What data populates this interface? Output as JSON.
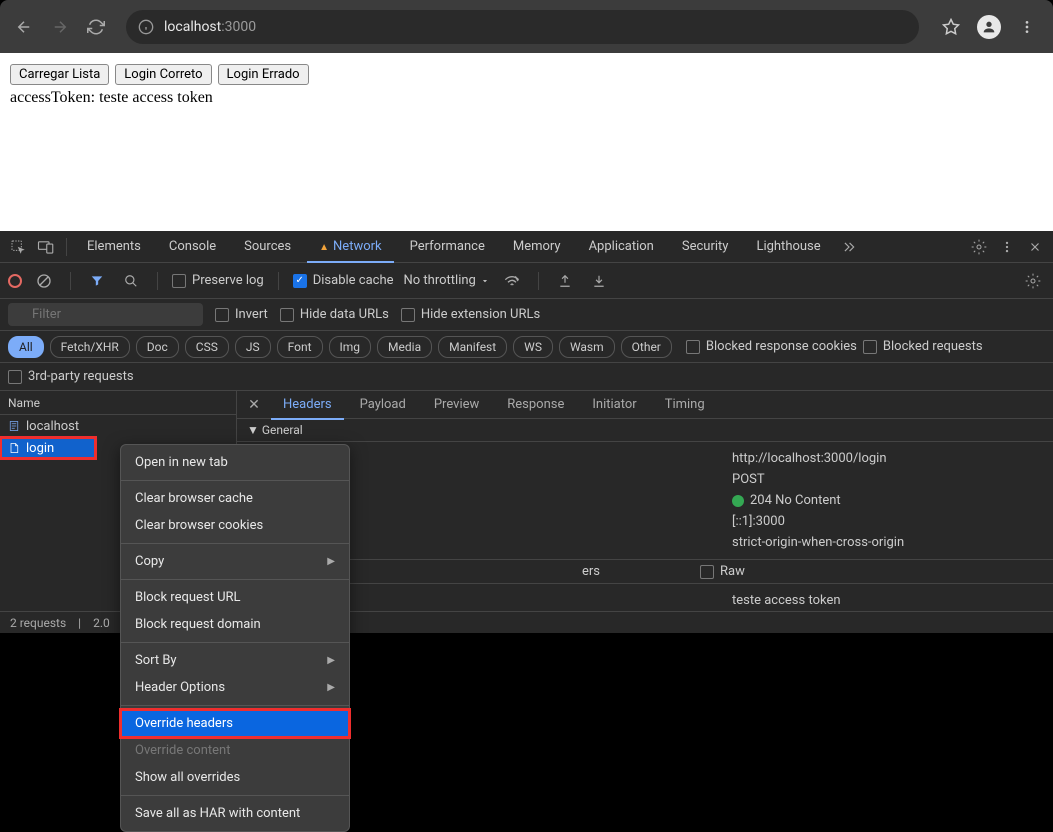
{
  "url": {
    "prefix": "localhost",
    "suffix": ":3000"
  },
  "page": {
    "buttons": [
      "Carregar Lista",
      "Login Correto",
      "Login Errado"
    ],
    "text": "accessToken: teste access token"
  },
  "devtools_tabs": [
    "Elements",
    "Console",
    "Sources",
    "Network",
    "Performance",
    "Memory",
    "Application",
    "Security",
    "Lighthouse"
  ],
  "active_tab": "Network",
  "controls": {
    "preserve_log": "Preserve log",
    "disable_cache": "Disable cache",
    "throttling": "No throttling"
  },
  "filter": {
    "placeholder": "Filter",
    "invert": "Invert",
    "hide_data": "Hide data URLs",
    "hide_ext": "Hide extension URLs"
  },
  "types": [
    "All",
    "Fetch/XHR",
    "Doc",
    "CSS",
    "JS",
    "Font",
    "Img",
    "Media",
    "Manifest",
    "WS",
    "Wasm",
    "Other"
  ],
  "types_extra": {
    "blocked_cookies": "Blocked response cookies",
    "blocked_requests": "Blocked requests",
    "third_party": "3rd-party requests"
  },
  "request_list": {
    "header": "Name",
    "items": [
      "localhost",
      "login"
    ]
  },
  "detail_tabs": [
    "Headers",
    "Payload",
    "Preview",
    "Response",
    "Initiator",
    "Timing"
  ],
  "general": {
    "title": "General",
    "url": "http://localhost:3000/login",
    "method": "POST",
    "status": "204 No Content",
    "addr": "[::1]:3000",
    "policy": "strict-origin-when-cross-origin"
  },
  "response_headers": {
    "title": "ers",
    "raw": "Raw",
    "value": "teste access token"
  },
  "footer": {
    "requests": "2 requests",
    "transfer": "2.0"
  },
  "context_menu": [
    {
      "label": "Open in new tab",
      "type": "item"
    },
    {
      "type": "sep"
    },
    {
      "label": "Clear browser cache",
      "type": "item"
    },
    {
      "label": "Clear browser cookies",
      "type": "item"
    },
    {
      "type": "sep"
    },
    {
      "label": "Copy",
      "type": "submenu"
    },
    {
      "type": "sep"
    },
    {
      "label": "Block request URL",
      "type": "item"
    },
    {
      "label": "Block request domain",
      "type": "item"
    },
    {
      "type": "sep"
    },
    {
      "label": "Sort By",
      "type": "submenu"
    },
    {
      "label": "Header Options",
      "type": "submenu"
    },
    {
      "type": "sep"
    },
    {
      "label": "Override headers",
      "type": "selected"
    },
    {
      "label": "Override content",
      "type": "disabled"
    },
    {
      "label": "Show all overrides",
      "type": "item"
    },
    {
      "type": "sep"
    },
    {
      "label": "Save all as HAR with content",
      "type": "item"
    }
  ]
}
